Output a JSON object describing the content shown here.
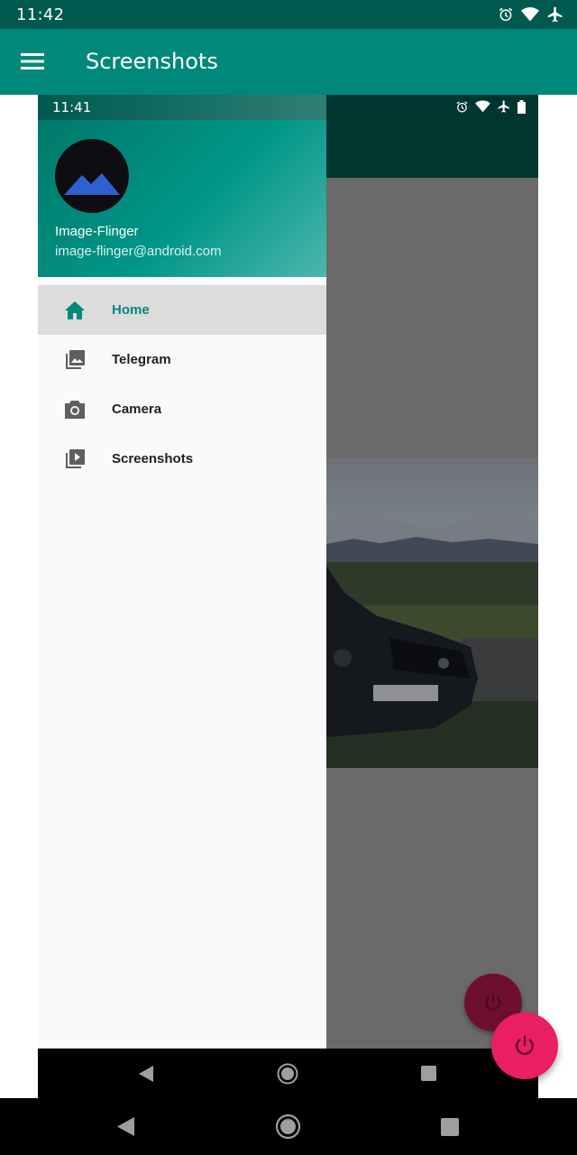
{
  "status_bar": {
    "time": "11:42",
    "icons": [
      "alarm-icon",
      "wifi-icon",
      "airplane-icon"
    ]
  },
  "app_bar": {
    "title": "Screenshots",
    "menu_icon": "hamburger-menu-icon",
    "color": "#00897b"
  },
  "screenshot": {
    "status_time": "11:41",
    "status_icons": [
      "alarm-icon",
      "wifi-icon",
      "airplane-icon",
      "battery-icon"
    ],
    "drawer": {
      "name": "Image-Flinger",
      "email": "image-flinger@android.com",
      "items": [
        {
          "label": "Home",
          "icon": "home-icon",
          "active": true
        },
        {
          "label": "Telegram",
          "icon": "photo-library-icon",
          "active": false
        },
        {
          "label": "Camera",
          "icon": "camera-icon",
          "active": false
        },
        {
          "label": "Screenshots",
          "icon": "video-library-icon",
          "active": false
        }
      ]
    },
    "fab_icon": "power-icon"
  },
  "fab": {
    "icon": "power-icon",
    "color": "#e91e63"
  },
  "nav_bar": {
    "buttons": [
      "back-icon",
      "home-circle-icon",
      "recents-icon"
    ]
  },
  "colors": {
    "accent": "#00897b",
    "status_bar": "#00594f",
    "fab": "#e91e63"
  }
}
